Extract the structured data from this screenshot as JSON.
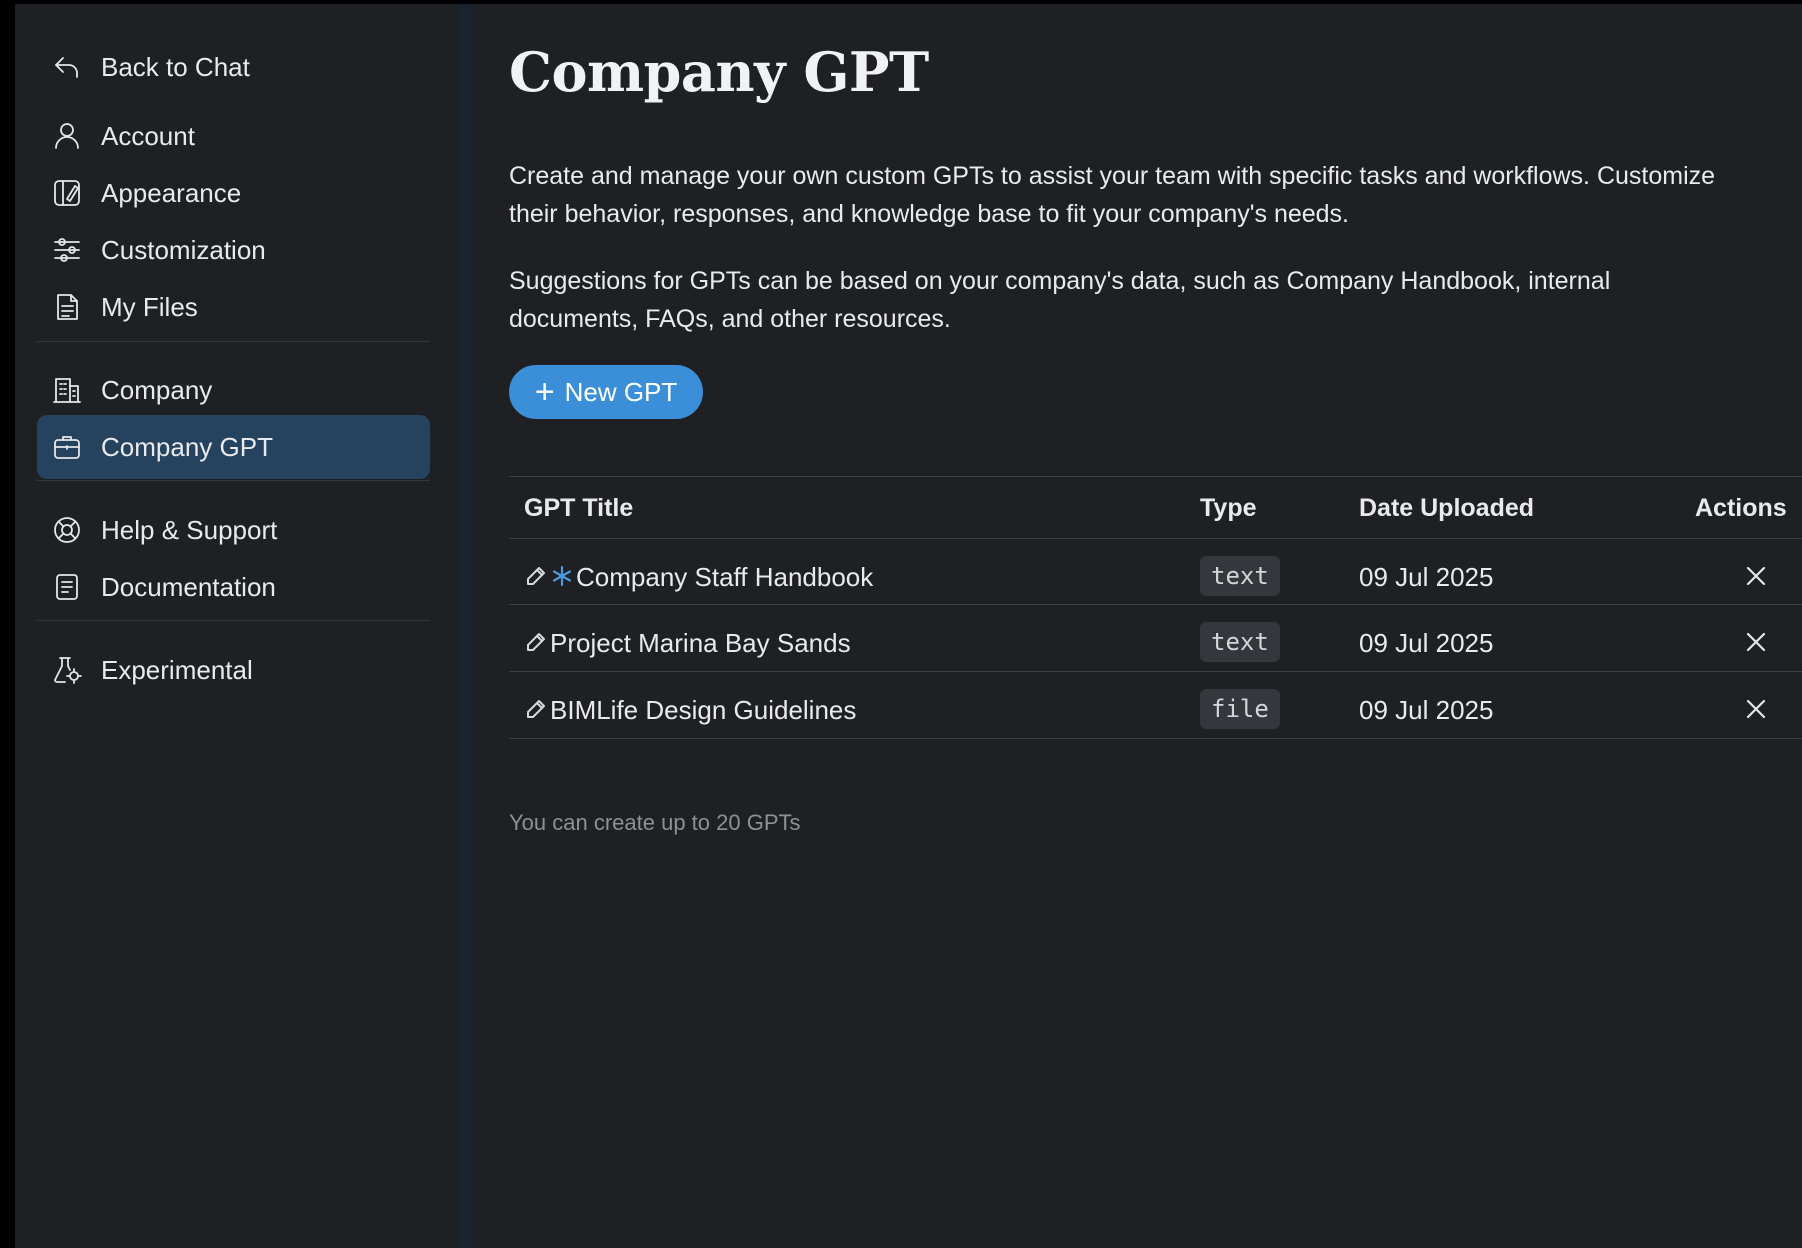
{
  "sidebar": {
    "back_label": "Back to Chat",
    "items": [
      {
        "label": "Account",
        "icon": "user-icon"
      },
      {
        "label": "Appearance",
        "icon": "appearance-icon"
      },
      {
        "label": "Customization",
        "icon": "sliders-icon"
      },
      {
        "label": "My Files",
        "icon": "file-icon"
      },
      {
        "label": "Company",
        "icon": "building-icon"
      },
      {
        "label": "Company GPT",
        "icon": "briefcase-icon",
        "active": true
      },
      {
        "label": "Help & Support",
        "icon": "lifebuoy-icon"
      },
      {
        "label": "Documentation",
        "icon": "document-icon"
      },
      {
        "label": "Experimental",
        "icon": "flask-icon"
      }
    ]
  },
  "main": {
    "title": "Company GPT",
    "description_1": "Create and manage your own custom GPTs to assist your team with specific tasks and workflows. Customize their behavior, responses, and knowledge base to fit your company's needs.",
    "description_2": "Suggestions for GPTs can be based on your company's data, such as Company Handbook, internal documents, FAQs, and other resources.",
    "new_button_label": "New GPT",
    "table": {
      "headers": {
        "title": "GPT Title",
        "type": "Type",
        "date": "Date Uploaded",
        "actions": "Actions"
      },
      "rows": [
        {
          "title": "Company Staff Handbook",
          "type": "text",
          "date": "09 Jul 2025",
          "featured": true
        },
        {
          "title": "Project Marina Bay Sands",
          "type": "text",
          "date": "09 Jul 2025",
          "featured": false
        },
        {
          "title": "BIMLife Design Guidelines",
          "type": "file",
          "date": "09 Jul 2025",
          "featured": false
        }
      ]
    },
    "footnote": "You can create up to 20 GPTs"
  },
  "colors": {
    "background": "#1f2023",
    "active_item": "#25435f",
    "accent": "#3a8fd8",
    "badge": "#34373c"
  }
}
